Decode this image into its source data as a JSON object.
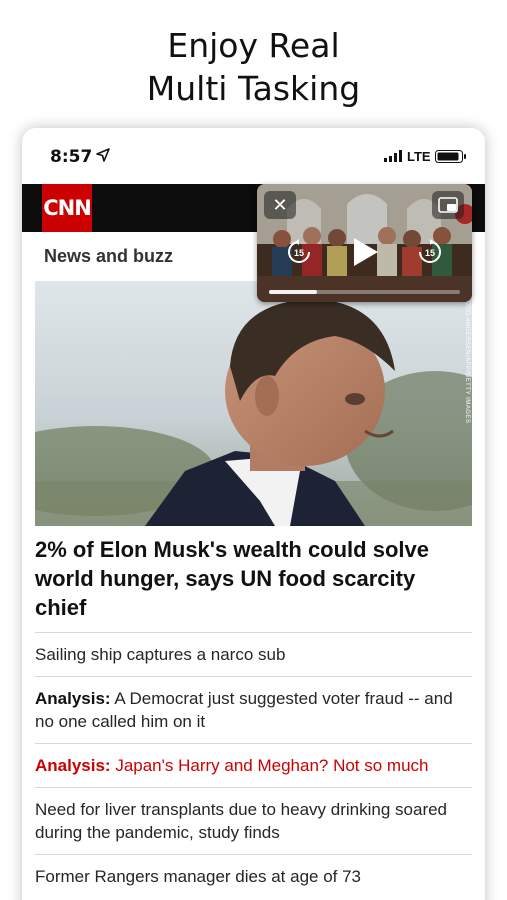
{
  "promo": {
    "line1": "Enjoy Real",
    "line2": "Multi Tasking"
  },
  "status_bar": {
    "time": "8:57",
    "network": "LTE"
  },
  "header": {
    "logo_text": "CNN",
    "brand_color": "#cc0000"
  },
  "section": {
    "title": "News and buzz"
  },
  "hero": {
    "photo_credit": "ODD ANDERSEN/AFP/GETTY IMAGES"
  },
  "pip": {
    "skip_back": "15",
    "skip_forward": "15",
    "progress": 0.25
  },
  "headline": "2% of Elon Musk's wealth could solve world hunger, says UN food scarcity chief",
  "stories": [
    {
      "prefix": "",
      "text": "Sailing ship captures a narco sub"
    },
    {
      "prefix": "Analysis:",
      "text": " A Democrat just suggested voter fraud -- and no one called him on it"
    },
    {
      "prefix": "Analysis:",
      "text": " Japan's Harry and Meghan? Not so much"
    },
    {
      "prefix": "",
      "text": "Need for liver transplants due to heavy drinking soared during the pandemic, study finds"
    },
    {
      "prefix": "",
      "text": "Former Rangers manager dies at age of 73"
    }
  ]
}
